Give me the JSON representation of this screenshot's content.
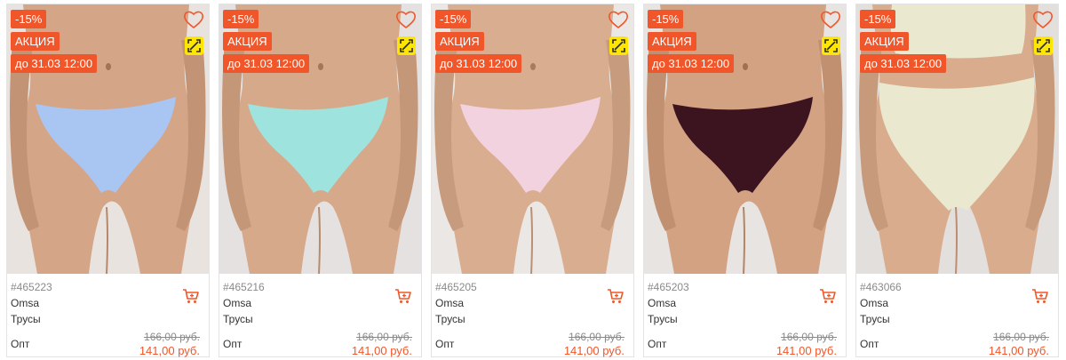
{
  "colors": {
    "accent": "#f0562a",
    "scan_badge": "#ffe600"
  },
  "products": [
    {
      "discount": "-15%",
      "promo": "АКЦИЯ",
      "deadline": "до 31.03 12:00",
      "sku": "#465223",
      "brand": "Omsa",
      "type": "Трусы",
      "opt_label": "Опт",
      "old_price": "166,00 руб.",
      "price": "141,00 руб.",
      "garment_color": "#a9c6f3",
      "skin": "#d4a587",
      "bg": "#e9e3df",
      "garment_style": "thong"
    },
    {
      "discount": "-15%",
      "promo": "АКЦИЯ",
      "deadline": "до 31.03 12:00",
      "sku": "#465216",
      "brand": "Omsa",
      "type": "Трусы",
      "opt_label": "Опт",
      "old_price": "166,00 руб.",
      "price": "141,00 руб.",
      "garment_color": "#9fe3df",
      "skin": "#d6a98a",
      "bg": "#e4e1e0",
      "garment_style": "thong"
    },
    {
      "discount": "-15%",
      "promo": "АКЦИЯ",
      "deadline": "до 31.03 12:00",
      "sku": "#465205",
      "brand": "Omsa",
      "type": "Трусы",
      "opt_label": "Опт",
      "old_price": "166,00 руб.",
      "price": "141,00 руб.",
      "garment_color": "#f2d2de",
      "skin": "#d9ad8f",
      "bg": "#ebe7e4",
      "garment_style": "thong"
    },
    {
      "discount": "-15%",
      "promo": "АКЦИЯ",
      "deadline": "до 31.03 12:00",
      "sku": "#465203",
      "brand": "Omsa",
      "type": "Трусы",
      "opt_label": "Опт",
      "old_price": "166,00 руб.",
      "price": "141,00 руб.",
      "garment_color": "#3b1420",
      "skin": "#d3a283",
      "bg": "#e8e4e1",
      "garment_style": "thong"
    },
    {
      "discount": "-15%",
      "promo": "АКЦИЯ",
      "deadline": "до 31.03 12:00",
      "sku": "#463066",
      "brand": "Omsa",
      "type": "Трусы",
      "opt_label": "Опт",
      "old_price": "166,00 руб.",
      "price": "141,00 руб.",
      "garment_color": "#eae8cf",
      "skin": "#d9ac8e",
      "bg": "#e2dfdc",
      "garment_style": "highwaist"
    }
  ]
}
